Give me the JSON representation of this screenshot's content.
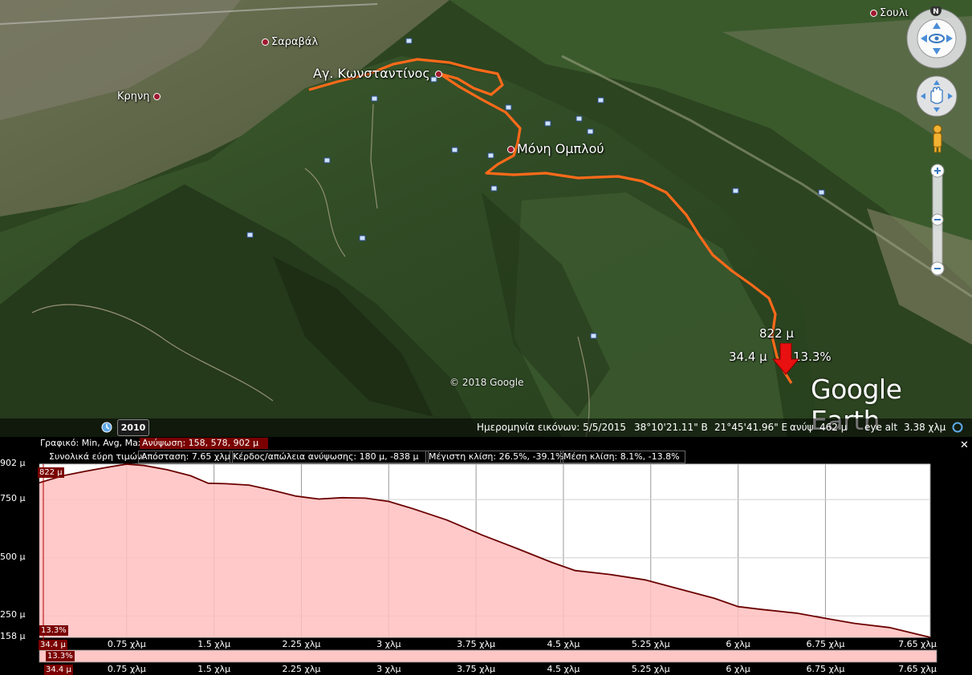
{
  "colors": {
    "route": "#ff6a1a",
    "elevation_line": "#6b0000",
    "elevation_fill": "#ffc0c0",
    "selected_stat_bg": "#7a0000",
    "place_marker": "#a01830"
  },
  "map": {
    "places": [
      {
        "name": "Σαραβάλ"
      },
      {
        "name": "Αγ. Κωνσταντίνος"
      },
      {
        "name": "Κρηνη"
      },
      {
        "name": "Σουλι"
      },
      {
        "name": "Μόνη Ομπλού"
      }
    ],
    "callout": {
      "elevation": "822 μ",
      "distance": "34.4 μ",
      "slope": "13.3%"
    },
    "copyright": "© 2018 Google",
    "brand": "Google Earth",
    "compass_label": "N",
    "icons": [
      "compass-icon",
      "look-around-icon",
      "hand-pan-icon",
      "street-view-pegman-icon",
      "zoom-in-icon",
      "zoom-out-icon",
      "historical-imagery-icon"
    ]
  },
  "status": {
    "historical_year": "2010",
    "imagery_date": "Ημερομηνία εικόνων: 5/5/2015",
    "latitude": "38°10'21.11\" Β",
    "longitude": "21°45'41.96\" Ε",
    "elevation_label": "ανύψ",
    "elevation_value": "462 μ",
    "eye_alt_label": "eye alt",
    "eye_alt_value": "3.38 χλμ"
  },
  "profile": {
    "graph_label": "Γραφικό: Min, Avg, Max",
    "elevation_stats": "Ανύψωση: 158, 578, 902 μ",
    "totals_label": "Συνολικά εύρη τιμών:",
    "distance": "Απόσταση: 7.65 χλμ",
    "gain_loss": "Κέρδος/απώλεια ανύψωσης: 180 μ, -838 μ",
    "max_slope": "Μέγιστη κλίση: 26.5%, -39.1%",
    "avg_slope": "Μέση κλίση: 8.1%, -13.8%",
    "current_elevation_tag": "822 μ",
    "current_slope_tag": "13.3%",
    "current_distance_tag": "34.4 μ",
    "slope_bar_tag": "13.3%",
    "slope_bar_distance_tag": "34.4 μ"
  },
  "chart_data": {
    "type": "area",
    "xlabel": "",
    "ylabel": "",
    "xlim": [
      0,
      7.65
    ],
    "ylim": [
      158,
      902
    ],
    "y_ticks": [
      {
        "value": 902,
        "label": "902 μ"
      },
      {
        "value": 750,
        "label": "750 μ"
      },
      {
        "value": 500,
        "label": "500 μ"
      },
      {
        "value": 250,
        "label": "250 μ"
      },
      {
        "value": 158,
        "label": "158 μ"
      }
    ],
    "x_ticks": [
      {
        "value": 0.75,
        "label": "0.75 χλμ"
      },
      {
        "value": 1.5,
        "label": "1.5 χλμ"
      },
      {
        "value": 2.25,
        "label": "2.25 χλμ"
      },
      {
        "value": 3,
        "label": "3 χλμ"
      },
      {
        "value": 3.75,
        "label": "3.75 χλμ"
      },
      {
        "value": 4.5,
        "label": "4.5 χλμ"
      },
      {
        "value": 5.25,
        "label": "5.25 χλμ"
      },
      {
        "value": 6,
        "label": "6 χλμ"
      },
      {
        "value": 6.75,
        "label": "6.75 χλμ"
      },
      {
        "value": 7.65,
        "label": "7.65 χλμ"
      }
    ],
    "x": [
      0,
      0.2,
      0.4,
      0.6,
      0.75,
      0.9,
      1.1,
      1.3,
      1.45,
      1.6,
      1.8,
      2.0,
      2.2,
      2.4,
      2.6,
      2.8,
      3.0,
      3.2,
      3.5,
      3.8,
      4.1,
      4.4,
      4.6,
      4.9,
      5.2,
      5.5,
      5.8,
      6.0,
      6.2,
      6.5,
      6.8,
      7.0,
      7.3,
      7.65
    ],
    "series": [
      {
        "values": [
          822,
          852,
          872,
          890,
          902,
          896,
          878,
          852,
          820,
          818,
          812,
          790,
          765,
          752,
          758,
          756,
          742,
          712,
          662,
          598,
          540,
          480,
          445,
          428,
          405,
          365,
          325,
          290,
          278,
          262,
          235,
          218,
          200,
          158
        ]
      }
    ],
    "grid": true,
    "cursor": {
      "x": 0.0344,
      "elevation": 822,
      "slope": "13.3%"
    }
  }
}
